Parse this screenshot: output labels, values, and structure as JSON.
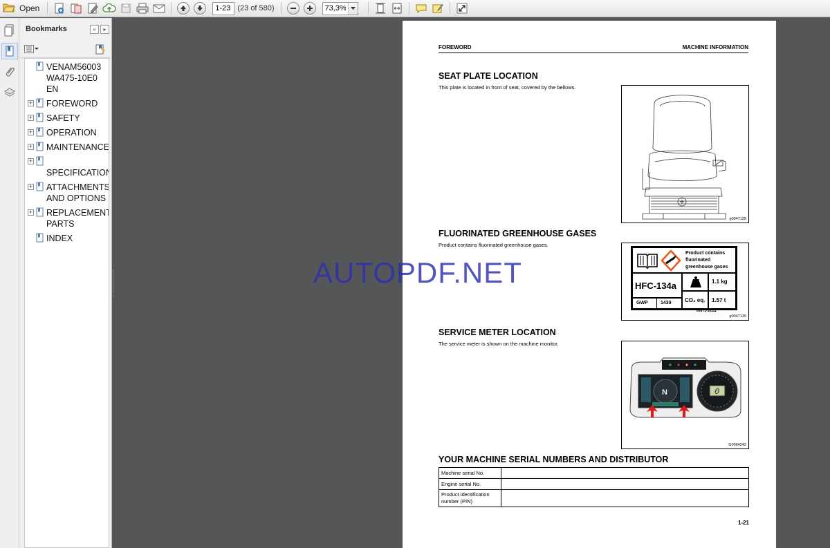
{
  "toolbar": {
    "open_label": "Open",
    "page_input": "1-23",
    "page_count": "(23 of 580)",
    "zoom_value": "73,3%"
  },
  "bookmarks": {
    "title": "Bookmarks",
    "items": [
      {
        "label": "VENAM56003\nWA475-10E0 EN",
        "expandable": false
      },
      {
        "label": "FOREWORD",
        "expandable": true
      },
      {
        "label": "SAFETY",
        "expandable": true
      },
      {
        "label": "OPERATION",
        "expandable": true
      },
      {
        "label": "MAINTENANCE",
        "expandable": true
      },
      {
        "label": "\nSPECIFICATIONS",
        "expandable": true
      },
      {
        "label": "ATTACHMENTS\nAND OPTIONS",
        "expandable": true
      },
      {
        "label": "REPLACEMENT\nPARTS",
        "expandable": true
      },
      {
        "label": "INDEX",
        "expandable": false
      }
    ]
  },
  "page": {
    "header_left": "FOREWORD",
    "header_right": "MACHINE INFORMATION",
    "seat": {
      "title": "SEAT PLATE LOCATION",
      "body": "This plate is located in front of seat, covered by the bellows.",
      "fig_code": "g0047129"
    },
    "gases": {
      "title": "FLUORINATED GREENHOUSE GASES",
      "body": "Product contains fluorinated greenhouse gases.",
      "label_text_1": "Product contains",
      "label_text_2": "fluorinated",
      "label_text_3": "greenhouse gases",
      "refrigerant": "HFC-134a",
      "gwp_key": "GWP",
      "gwp_value": "1430",
      "mass": "1.1 kg",
      "co2_key": "CO₂ eq.",
      "co2_value": "1.57 t",
      "part_no": "09971-10111",
      "fig_code": "g0047139"
    },
    "meter": {
      "title": "SERVICE METER LOCATION",
      "body": "The service meter is shown on the machine monitor.",
      "gear": "N",
      "digit": "0",
      "fig_code": "G0064242"
    },
    "serials": {
      "title": "YOUR MACHINE SERIAL NUMBERS AND DISTRIBUTOR",
      "rows": [
        {
          "key": "Machine serial No.",
          "value": ""
        },
        {
          "key": "Engine serial No.",
          "value": ""
        },
        {
          "key": "Product identification\nnumber (PIN)",
          "value": ""
        }
      ]
    },
    "page_number": "1-21"
  },
  "watermark": "AUTOPDF.NET",
  "colors": {
    "doc_background": "#555657",
    "watermark": "#2b2fb0",
    "accent_orange": "#e85a1b",
    "arrow_red": "#e01818"
  },
  "icons": [
    "open-folder-icon",
    "create-pdf-icon",
    "combine-icon",
    "edit-icon",
    "upload-cloud-icon",
    "save-icon",
    "print-icon",
    "email-icon",
    "previous-page-icon",
    "next-page-icon",
    "zoom-out-icon",
    "zoom-in-icon",
    "fit-page-icon",
    "fit-width-icon",
    "comment-icon",
    "sign-icon",
    "fullscreen-icon"
  ]
}
